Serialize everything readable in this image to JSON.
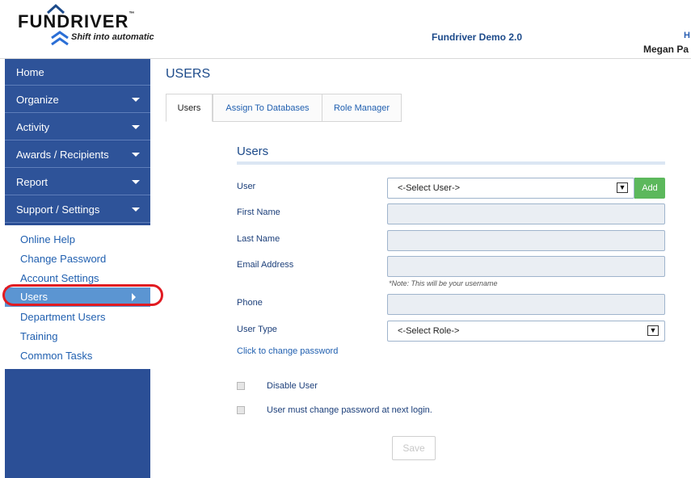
{
  "header": {
    "brand": "FUNDRIVER",
    "brand_tm": "™",
    "tagline": "Shift into automatic",
    "app_title": "Fundriver Demo 2.0",
    "top_link": "H",
    "user_name": "Megan Pa"
  },
  "sidebar": {
    "items": [
      {
        "label": "Home"
      },
      {
        "label": "Organize"
      },
      {
        "label": "Activity"
      },
      {
        "label": "Awards / Recipients"
      },
      {
        "label": "Report"
      },
      {
        "label": "Support / Settings"
      }
    ],
    "sub_items": [
      {
        "label": "Online Help"
      },
      {
        "label": "Change Password"
      },
      {
        "label": "Account Settings"
      },
      {
        "label": "Users"
      },
      {
        "label": "Department Users"
      },
      {
        "label": "Training"
      },
      {
        "label": "Common Tasks"
      }
    ],
    "active_sub_index": 3,
    "highlight_color": "#e11b22"
  },
  "main": {
    "page_title": "USERS",
    "tabs": [
      {
        "label": "Users",
        "active": true
      },
      {
        "label": "Assign To Databases",
        "active": false
      },
      {
        "label": "Role Manager",
        "active": false
      }
    ],
    "section_title": "Users",
    "form": {
      "user_label": "User",
      "user_select_value": "<-Select User->",
      "add_label": "Add",
      "first_name_label": "First Name",
      "first_name_value": "",
      "last_name_label": "Last Name",
      "last_name_value": "",
      "email_label": "Email Address",
      "email_value": "",
      "email_note": "*Note: This will be your username",
      "phone_label": "Phone",
      "phone_value": "",
      "user_type_label": "User Type",
      "user_type_value": "<-Select Role->",
      "change_password_link": "Click to change password",
      "disable_user_label": "Disable User",
      "must_change_label": "User must change password at next login.",
      "save_label": "Save"
    },
    "colors": {
      "accent": "#1c4a8a",
      "add_button": "#5cb85c",
      "sidebar": "#2b4f96"
    }
  }
}
